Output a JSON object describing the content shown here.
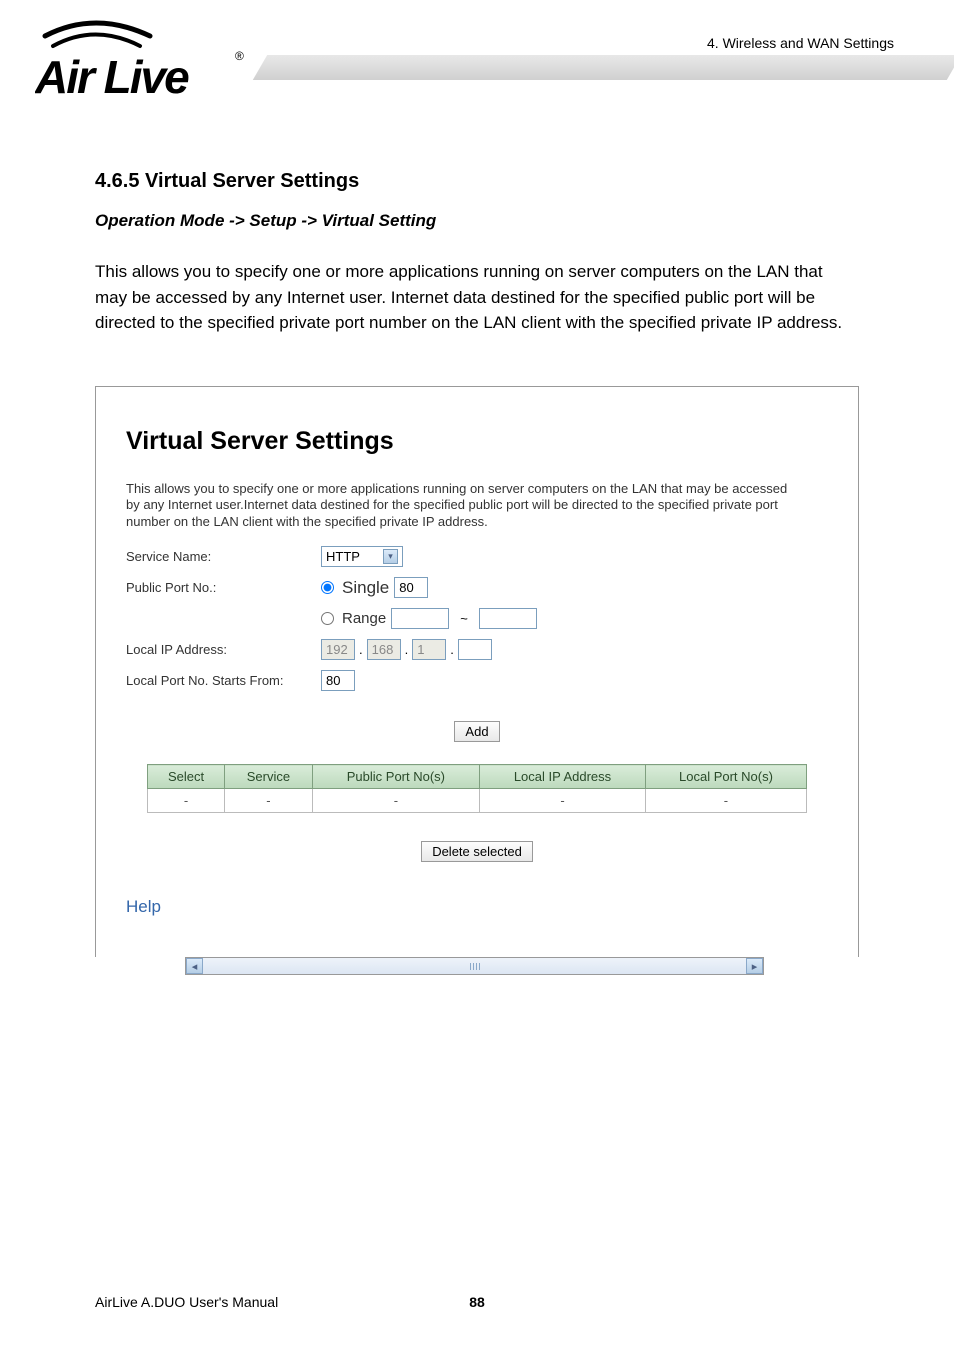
{
  "header": {
    "breadcrumb": "4. Wireless and WAN Settings",
    "logo_text": "Air Live"
  },
  "section": {
    "title": "4.6.5 Virtual Server Settings",
    "operation_path": "Operation Mode -> Setup -> Virtual Setting",
    "intro": "This allows you to specify one or more applications running on server computers on the LAN that may be accessed by any Internet user. Internet data destined for the specified public port will be directed to the specified private port number on the LAN client with the specified private IP address."
  },
  "panel": {
    "title": "Virtual Server Settings",
    "description": "This allows you to specify one or more applications running on server computers on the LAN that may be accessed by any Internet user.Internet data destined for the specified public port will be directed to the specified private port number on the LAN client with the specified private IP address.",
    "labels": {
      "service_name": "Service Name:",
      "public_port": "Public Port No.:",
      "local_ip": "Local IP Address:",
      "local_port_start": "Local Port No. Starts From:"
    },
    "service_select": "HTTP",
    "radio_single": "Single",
    "radio_range": "Range",
    "single_port": "80",
    "ip_octet1": "192",
    "ip_octet2": "168",
    "ip_octet3": "1",
    "local_port_value": "80",
    "add_button": "Add",
    "delete_button": "Delete selected",
    "help_link": "Help",
    "table": {
      "headers": {
        "select": "Select",
        "service": "Service",
        "public_port": "Public Port No(s)",
        "local_ip": "Local IP Address",
        "local_port": "Local Port No(s)"
      },
      "empty": "-"
    }
  },
  "footer": {
    "manual": "AirLive A.DUO User's Manual",
    "page": "88"
  }
}
